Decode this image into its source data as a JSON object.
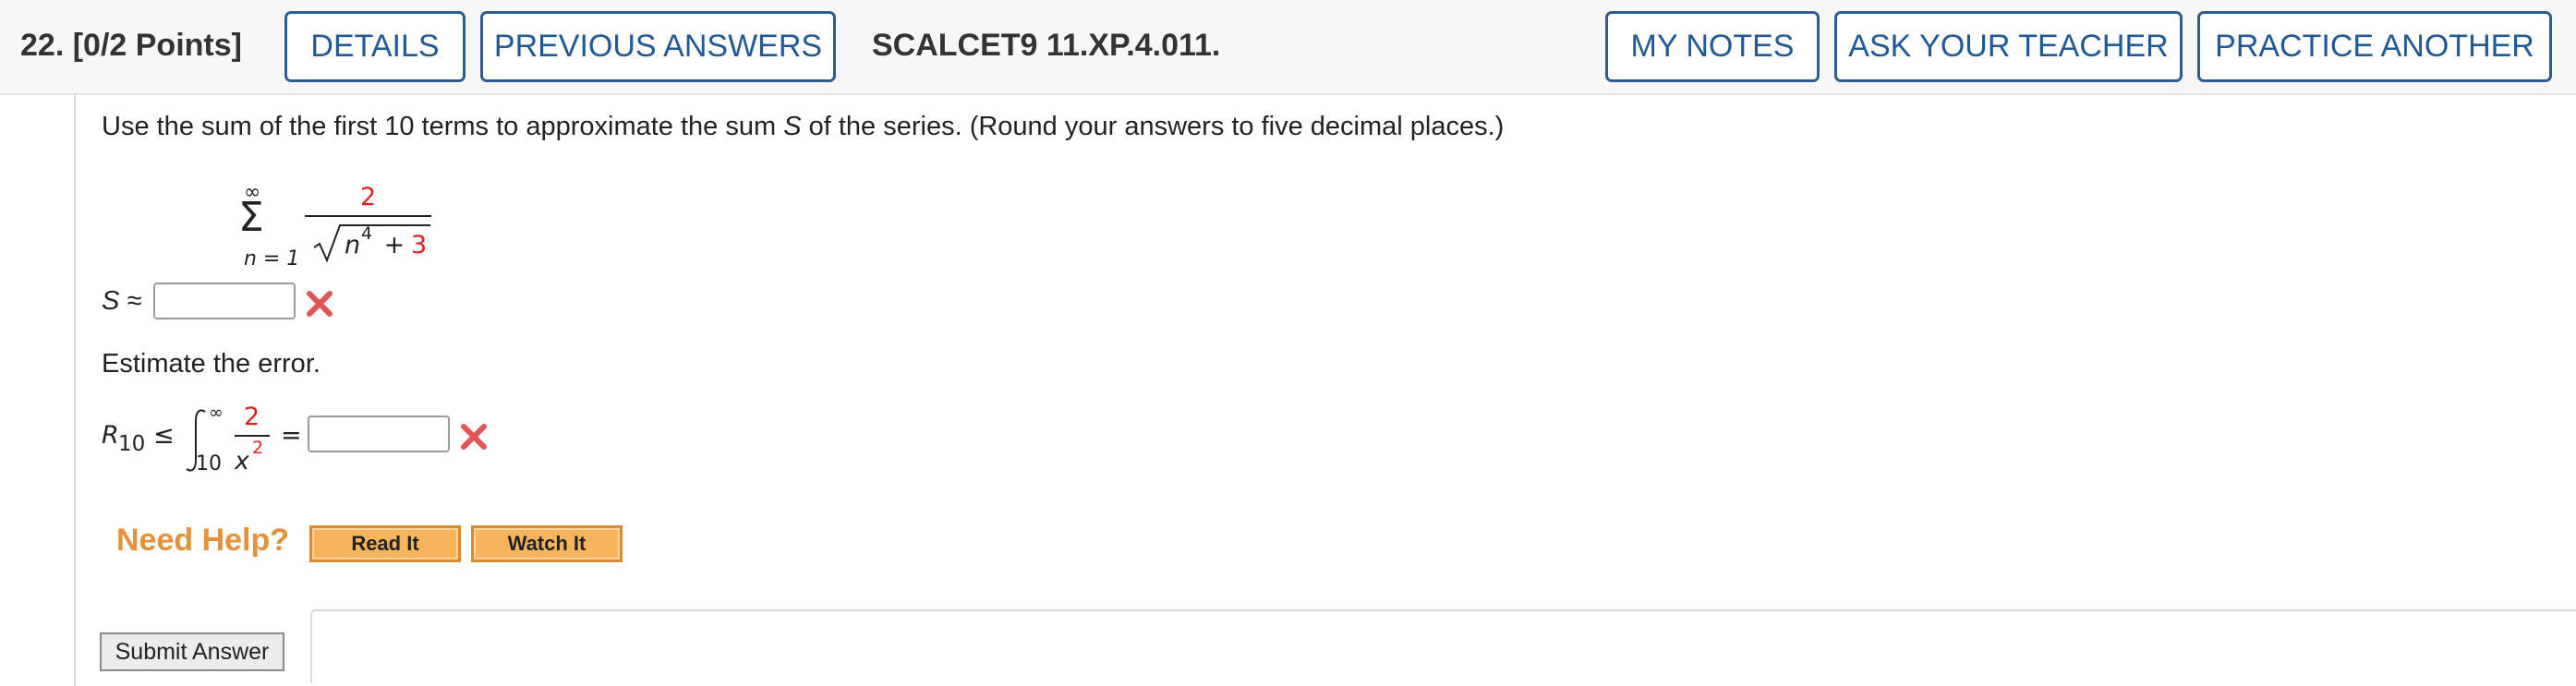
{
  "header": {
    "question_label": "22.  [0/2 Points]",
    "details_label": "DETAILS",
    "previous_answers_label": "PREVIOUS ANSWERS",
    "question_code": "SCALCET9 11.XP.4.011.",
    "my_notes_label": "MY NOTES",
    "ask_teacher_label": "ASK YOUR TEACHER",
    "practice_another_label": "PRACTICE ANOTHER"
  },
  "question": {
    "prompt_before": "Use the sum of the first 10 terms to approximate the sum ",
    "prompt_var": "S",
    "prompt_after": " of the series. (Round your answers to five decimal places.)",
    "series": {
      "upper": "∞",
      "sigma": "Σ",
      "lower": "n = 1",
      "numerator": "2",
      "radicand_var": "n",
      "radicand_exp": "4",
      "radicand_plus": " + ",
      "radicand_const": "3"
    },
    "s_label": "S ≈",
    "s_value": "",
    "error_prompt": "Estimate the error.",
    "error": {
      "r_label": "R",
      "r_sub": "10",
      "le": "≤",
      "integral_upper": "∞",
      "integral_lower": "10",
      "numerator": "2",
      "denominator_var": "x",
      "denominator_exp": "2",
      "equals": "="
    },
    "error_value": ""
  },
  "help": {
    "need_help_label": "Need Help?",
    "read_it_label": "Read It",
    "watch_it_label": "Watch It"
  },
  "submit_label": "Submit Answer",
  "colors": {
    "accent": "#1f5a96",
    "highlight_red": "#e02020",
    "help_orange": "#e3913b"
  }
}
